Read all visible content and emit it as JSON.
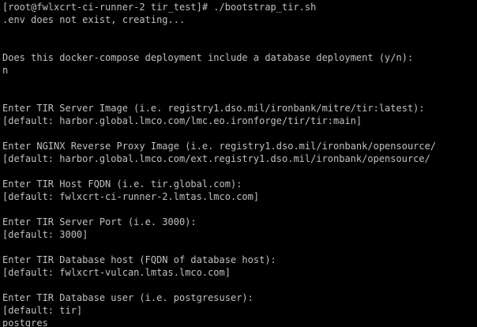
{
  "terminal": {
    "colors": {
      "background": "#000000",
      "foreground": "#c0c0c0"
    },
    "lines": [
      "[root@fwlxcrt-ci-runner-2 tir_test]# ./bootstrap_tir.sh",
      ".env does not exist, creating...",
      "",
      "",
      "Does this docker-compose deployment include a database deployment (y/n):",
      "n",
      "",
      "",
      "Enter TIR Server Image (i.e. registry1.dso.mil/ironbank/mitre/tir:latest):",
      "[default: harbor.global.lmco.com/lmc.eo.ironforge/tir/tir:main]",
      "",
      "Enter NGINX Reverse Proxy Image (i.e. registry1.dso.mil/ironbank/opensource/",
      "[default: harbor.global.lmco.com/ext.registry1.dso.mil/ironbank/opensource/",
      "",
      "Enter TIR Host FQDN (i.e. tir.global.com):",
      "[default: fwlxcrt-ci-runner-2.lmtas.lmco.com]",
      "",
      "Enter TIR Server Port (i.e. 3000):",
      "[default: 3000]",
      "",
      "Enter TIR Database host (FQDN of database host):",
      "[default: fwlxcrt-vulcan.lmtas.lmco.com]",
      "",
      "Enter TIR Database user (i.e. postgresuser):",
      "[default: tir]",
      "postgres"
    ]
  }
}
